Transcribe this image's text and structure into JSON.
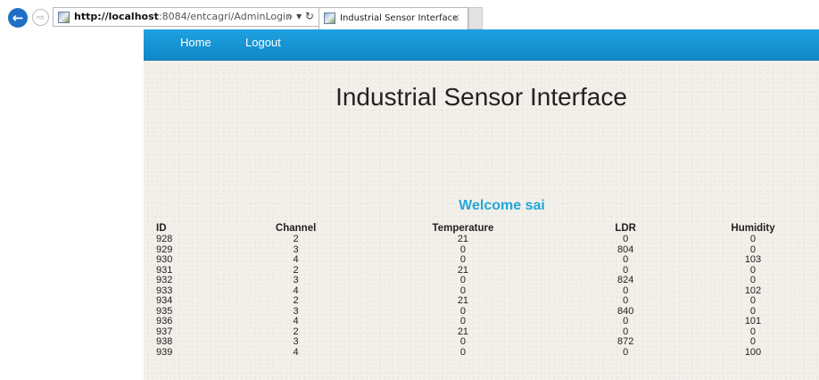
{
  "browser": {
    "url_host": "http://localhost",
    "url_path": ":8084/entcagri/AdminLogin",
    "addr_icons": "⌕ ▾ ↻",
    "tab_title": "Industrial Sensor Interface",
    "tab_close": "×",
    "back_icon": "←",
    "forward_icon": "⇨"
  },
  "nav": {
    "home": "Home",
    "logout": "Logout"
  },
  "page_title": "Industrial Sensor Interface",
  "welcome": "Welcome sai",
  "table": {
    "headers": [
      "ID",
      "Channel",
      "Temperature",
      "LDR",
      "Humidity"
    ],
    "rows": [
      [
        "928",
        "2",
        "21",
        "0",
        "0"
      ],
      [
        "929",
        "3",
        "0",
        "804",
        "0"
      ],
      [
        "930",
        "4",
        "0",
        "0",
        "103"
      ],
      [
        "931",
        "2",
        "21",
        "0",
        "0"
      ],
      [
        "932",
        "3",
        "0",
        "824",
        "0"
      ],
      [
        "933",
        "4",
        "0",
        "0",
        "102"
      ],
      [
        "934",
        "2",
        "21",
        "0",
        "0"
      ],
      [
        "935",
        "3",
        "0",
        "840",
        "0"
      ],
      [
        "936",
        "4",
        "0",
        "0",
        "101"
      ],
      [
        "937",
        "2",
        "21",
        "0",
        "0"
      ],
      [
        "938",
        "3",
        "0",
        "872",
        "0"
      ],
      [
        "939",
        "4",
        "0",
        "0",
        "100"
      ]
    ]
  },
  "colors": {
    "navbar": "#1c9ad9",
    "welcome": "#23a7db",
    "page_bg": "#f1eee8"
  }
}
